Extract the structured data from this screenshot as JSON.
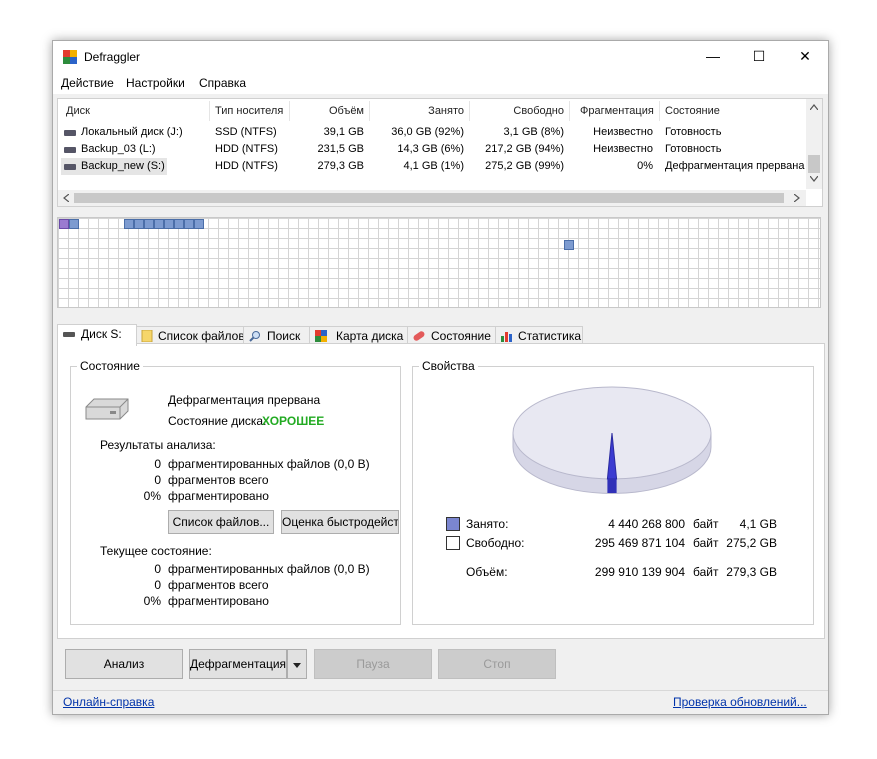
{
  "window": {
    "title": "Defraggler",
    "controls": {
      "minimize": "—",
      "maximize": "☐",
      "close": "✕"
    }
  },
  "menu": [
    "Действие",
    "Настройки",
    "Справка"
  ],
  "drive_table": {
    "headers": [
      "Диск",
      "Тип носителя",
      "Объём",
      "Занято",
      "Свободно",
      "Фрагментация",
      "Состояние"
    ],
    "rows": [
      [
        "Локальный диск (J:)",
        "SSD (NTFS)",
        "39,1 GB",
        "36,0 GB (92%)",
        "3,1 GB (8%)",
        "Неизвестно",
        "Готовность"
      ],
      [
        "Backup_03 (L:)",
        "HDD (NTFS)",
        "231,5 GB",
        "14,3 GB (6%)",
        "217,2 GB (94%)",
        "Неизвестно",
        "Готовность"
      ],
      [
        "Backup_new (S:)",
        "HDD (NTFS)",
        "279,3 GB",
        "4,1 GB (1%)",
        "275,2 GB (99%)",
        "0%",
        "Дефрагментация прервана"
      ]
    ],
    "selected_row": 2
  },
  "tabs": [
    "Диск S:",
    "Список файлов",
    "Поиск",
    "Карта диска",
    "Состояние",
    "Статистика"
  ],
  "status_group": {
    "title": "Состояние",
    "state_text": "Дефрагментация прервана",
    "health_label": "Состояние диска:",
    "health_value": "ХОРОШЕЕ",
    "analysis_title": "Результаты анализа:",
    "analysis": [
      {
        "value": "0",
        "label": "фрагментированных файлов (0,0 B)"
      },
      {
        "value": "0",
        "label": "фрагментов всего"
      },
      {
        "value": "0%",
        "label": "фрагментировано"
      }
    ],
    "btn_file_list": "Список файлов...",
    "btn_benchmark": "Оценка быстродейст",
    "current_title": "Текущее состояние:",
    "current": [
      {
        "value": "0",
        "label": "фрагментированных файлов (0,0 B)"
      },
      {
        "value": "0",
        "label": "фрагментов всего"
      },
      {
        "value": "0%",
        "label": "фрагментировано"
      }
    ]
  },
  "properties_group": {
    "title": "Свойства",
    "used_fraction": 0.0148,
    "rows": [
      {
        "label": "Занято:",
        "bytes": "4 440 268 800",
        "unit": "байт",
        "size": "4,1 GB",
        "swatch": "#7b86d0"
      },
      {
        "label": "Свободно:",
        "bytes": "295 469 871 104",
        "unit": "байт",
        "size": "275,2 GB",
        "swatch": "#ffffff"
      },
      {
        "label": "Объём:",
        "bytes": "299 910 139 904",
        "unit": "байт",
        "size": "279,3 GB",
        "swatch": ""
      }
    ]
  },
  "actions": {
    "analyze": "Анализ",
    "defrag": "Дефрагментация",
    "pause": "Пауза",
    "stop": "Стоп"
  },
  "footer": {
    "help_link": "Онлайн-справка",
    "update_link": "Проверка обновлений..."
  },
  "colors": {
    "health_good": "#22aa22",
    "used": "#7b86d0",
    "free": "#e8e8f2",
    "link": "#0033aa"
  }
}
